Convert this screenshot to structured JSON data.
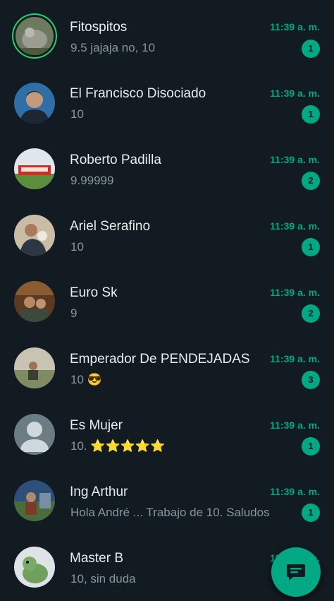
{
  "chats": [
    {
      "name": "Fitospitos",
      "preview": "9.5 jajaja no, 10",
      "time": "11:39 a. m.",
      "unread": "1"
    },
    {
      "name": "El Francisco Disociado",
      "preview": "10",
      "time": "11:39 a. m.",
      "unread": "1"
    },
    {
      "name": "Roberto Padilla",
      "preview": "9.99999",
      "time": "11:39 a. m.",
      "unread": "2"
    },
    {
      "name": "Ariel Serafino",
      "preview": "10",
      "time": "11:39 a. m.",
      "unread": "1"
    },
    {
      "name": "Euro Sk",
      "preview": "9",
      "time": "11:39 a. m.",
      "unread": "2"
    },
    {
      "name": "Emperador De PENDEJADAS",
      "preview": "10 😎",
      "time": "11:39 a. m.",
      "unread": "3"
    },
    {
      "name": "Es Mujer",
      "preview": "10. ⭐⭐⭐⭐⭐",
      "time": "11:39 a. m.",
      "unread": "1"
    },
    {
      "name": "Ing Arthur",
      "preview": "Hola André ... Trabajo de 10. Saludos",
      "time": "11:39 a. m.",
      "unread": "1"
    },
    {
      "name": "Master B",
      "preview": "10, sin duda",
      "time": "11:39 a. m.",
      "unread": ""
    }
  ],
  "fab": {
    "icon": "new-chat-icon"
  },
  "colors": {
    "background": "#111b21",
    "accent": "#00a884",
    "status_ring": "#25d366"
  }
}
